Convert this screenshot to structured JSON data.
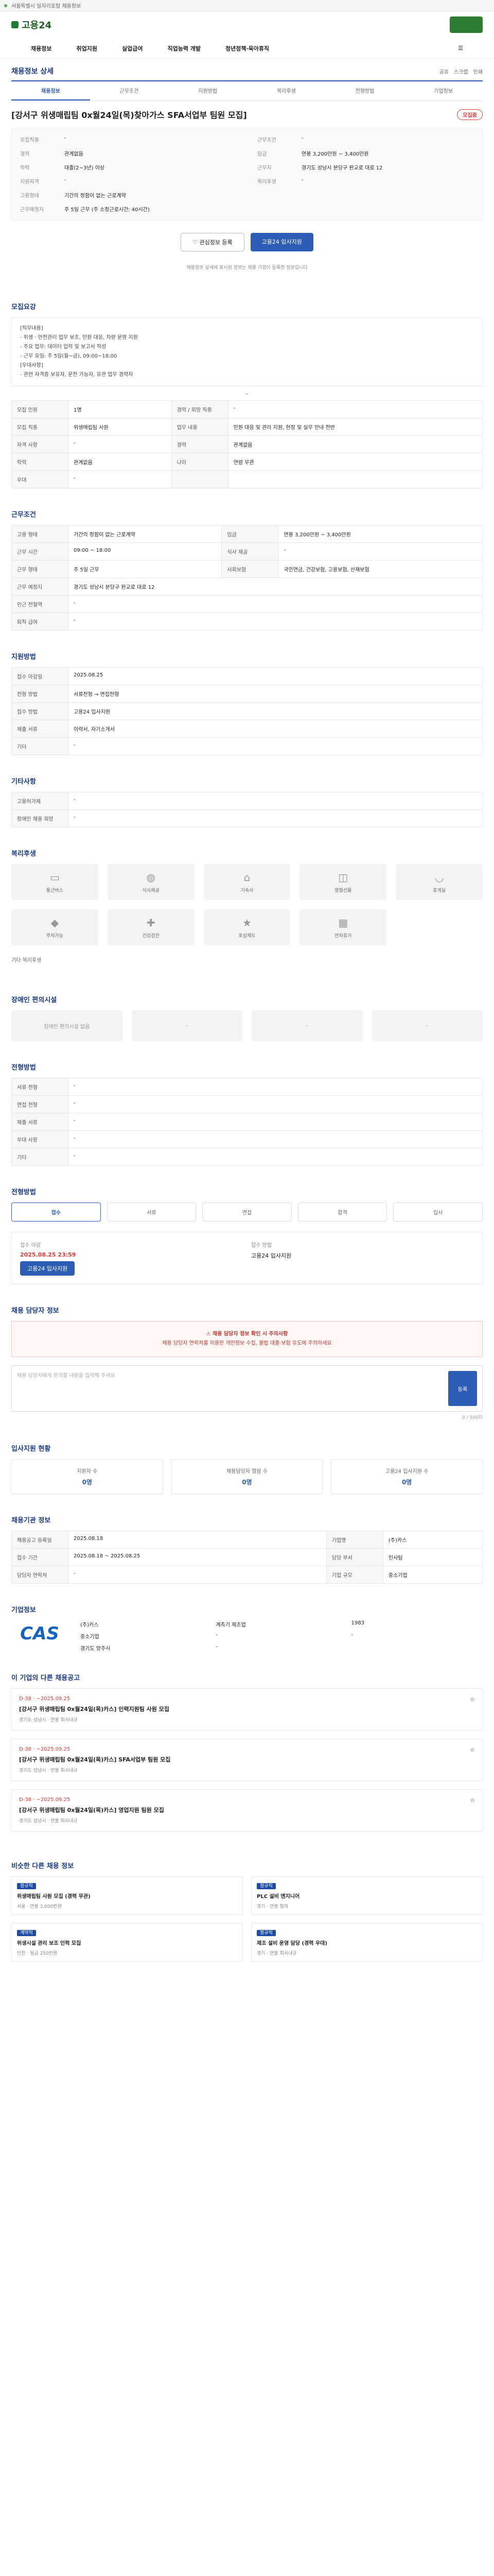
{
  "topbar": {
    "text": "서울특별시 일자리포털 채용정보"
  },
  "brand": {
    "name": "고용24"
  },
  "gnb": [
    "채용정보",
    "취업지원",
    "실업급여",
    "직업능력 개발",
    "청년정책·육아휴직"
  ],
  "breadcrumb": "채용정보 상세",
  "actions": [
    "공유",
    "스크랩",
    "인쇄"
  ],
  "tabs": [
    "채용정보",
    "근무조건",
    "지원방법",
    "복리후생",
    "전형방법",
    "기업정보"
  ],
  "job": {
    "title": "[강서구 위생매립팀 0x월24일(목)찾아가스 SFA서업부 팀원 모집]",
    "status": "모집중"
  },
  "summary": {
    "left": [
      {
        "k": "모집직종",
        "v": "-"
      },
      {
        "k": "경력",
        "v": "관계없음"
      },
      {
        "k": "학력",
        "v": "대졸(2~3년) 이상"
      },
      {
        "k": "지원자격",
        "v": "-"
      },
      {
        "k": "고용형태",
        "v": "기간의 정함이 없는 근로계약"
      },
      {
        "k": "근무예정지",
        "v": "주 5일 근무 (주 소정근로시간: 40시간)"
      }
    ],
    "right": [
      {
        "k": "근무조건",
        "v": "-"
      },
      {
        "k": "임금",
        "v": "연봉 3,200만원 ~ 3,400만원"
      },
      {
        "k": "근무지",
        "v": "경기도 성남시 분당구 판교로 대로 12"
      },
      {
        "k": "복리후생",
        "v": "-"
      }
    ]
  },
  "buttons": {
    "scrap": "관심정보 등록",
    "apply": "고용24 입사지원"
  },
  "notice": "채용정보 상세에 표시된 정보는 채용 기업이 등록한 정보입니다",
  "recruit_section": "모집요강",
  "duty_box": [
    "[직무내용]",
    "- 위생 · 안전관리 업무 보조, 민원 대응, 차량 운영 지원",
    "- 주요 업무: 데이터 입력 및 보고서 작성",
    "- 근무 요일: 주 5일(월~금), 09:00~18:00",
    "[우대사항]",
    "- 관련 자격증 보유자, 운전 가능자, 유관 업무 경력자"
  ],
  "recruit_rows": [
    {
      "k1": "모집 인원",
      "v1": "1명",
      "k2": "경력 / 희망 직종",
      "v2": "-"
    },
    {
      "k1": "모집 직종",
      "v1": "위생매립팀 사원",
      "k2": "업무 내용",
      "v2": "민원 대응 및 관리 지원, 현장 및 실무 안내 전반"
    },
    {
      "k1": "자격 사항",
      "v1": "-",
      "k2": "경력",
      "v2": "관계없음"
    },
    {
      "k1": "학력",
      "v1": "관계없음",
      "k2": "나이",
      "v2": "연령 무관"
    },
    {
      "k1": "우대",
      "v1": "-",
      "k2": "",
      "v2": ""
    }
  ],
  "condition_section": "근무조건",
  "condition_rows": [
    {
      "k1": "고용 형태",
      "v1": "기간의 정함이 없는 근로계약",
      "k2": "임금",
      "v2": "연봉 3,200만원 ~ 3,400만원"
    },
    {
      "k1": "근무 시간",
      "v1": "09:00 ~ 18:00",
      "k2": "식사 제공",
      "v2": "-"
    },
    {
      "k1": "근무 형태",
      "v1": "주 5일 근무",
      "k2": "사회보험",
      "v2": "국민연금, 건강보험, 고용보험, 산재보험"
    },
    {
      "k1": "근무 예정지",
      "v1": "경기도 성남시 분당구 판교로 대로 12",
      "k2": "",
      "v2": ""
    },
    {
      "k1": "인근 전철역",
      "v1": "-",
      "k2": "",
      "v2": ""
    },
    {
      "k1": "퇴직 급여",
      "v1": "-",
      "k2": "",
      "v2": ""
    }
  ],
  "apply_section": "지원방법",
  "apply_rows": [
    {
      "k": "접수 마감일",
      "v": "2025.08.25"
    },
    {
      "k": "전형 방법",
      "v": "서류전형 → 면접전형"
    },
    {
      "k": "접수 방법",
      "v": "고용24 입사지원"
    },
    {
      "k": "제출 서류",
      "v": "이력서, 자기소개서"
    },
    {
      "k": "기타",
      "v": "-"
    }
  ],
  "etc_section": "기타사항",
  "etc_rows": [
    {
      "k": "고용허가제",
      "v": "-"
    },
    {
      "k": "장애인 채용 희망",
      "v": "-"
    }
  ],
  "welfare_section": "복리후생",
  "welfare_items": [
    {
      "icon": "bus-icon",
      "label": "통근버스"
    },
    {
      "icon": "meal-icon",
      "label": "식사제공"
    },
    {
      "icon": "home-icon",
      "label": "기숙사"
    },
    {
      "icon": "gift-icon",
      "label": "명절선물"
    },
    {
      "icon": "coffee-icon",
      "label": "휴게실"
    },
    {
      "icon": "car-icon",
      "label": "주차가능"
    },
    {
      "icon": "health-icon",
      "label": "건강검진"
    },
    {
      "icon": "award-icon",
      "label": "포상제도"
    },
    {
      "icon": "calendar-icon",
      "label": "연차휴가"
    }
  ],
  "welfare_etc": "기타 복리후생",
  "disabled_section": "장애인 편의시설",
  "disabled_items": [
    "장애인 편의시설 없음",
    "-",
    "-",
    "-"
  ],
  "method_section": "전형방법",
  "method_rows": [
    {
      "k": "서류 전형",
      "v": "-"
    },
    {
      "k": "면접 전형",
      "v": "-"
    },
    {
      "k": "제출 서류",
      "v": "-"
    },
    {
      "k": "우대 사항",
      "v": "-"
    },
    {
      "k": "기타",
      "v": "-"
    }
  ],
  "process_section": "전형방법",
  "process_chips": [
    "접수",
    "서류",
    "면접",
    "합격",
    "입사"
  ],
  "deadline": {
    "label": "접수 마감",
    "date": "2025.08.25 23:59",
    "method_label": "접수 방법",
    "method": "고용24 입사지원",
    "apply": "고용24 입사지원"
  },
  "warning": {
    "title": "채용 담당자 정보 확인 시 주의사항",
    "body": "채용 담당자 연락처를 이용한 개인정보 수집, 불법 대출·보험 유도에 주의하세요"
  },
  "qna_section": "채용 담당자 정보",
  "qna": {
    "placeholder": "채용 담당자에게 문의할 내용을 입력해 주세요",
    "button": "등록",
    "count": "0 / 500자"
  },
  "stats_section": "입사지원 현황",
  "stats": [
    {
      "k": "지원자 수",
      "v": "0명"
    },
    {
      "k": "채용담당자 열람 수",
      "v": "0명"
    },
    {
      "k": "고용24 입사지원 수",
      "v": "0명"
    }
  ],
  "info_section": "채용기관 정보",
  "info_rows": [
    {
      "k1": "채용공고 등록일",
      "v1": "2025.08.18",
      "k2": "기업명",
      "v2": "(주)카스"
    },
    {
      "k1": "접수 기간",
      "v1": "2025.08.18 ~ 2025.08.25",
      "k2": "담당 부서",
      "v2": "인사팀"
    },
    {
      "k1": "담당자 연락처",
      "v1": "-",
      "k2": "기업 규모",
      "v2": "중소기업"
    }
  ],
  "company_section": "기업정보",
  "company": {
    "logo": "CAS",
    "name": "(주)카스",
    "ceo": "-",
    "industry": "계측기 제조업",
    "size": "중소기업",
    "founded": "1983",
    "employees": "-",
    "address": "경기도 양주시",
    "homepage": "-"
  },
  "related_section": "이 기업의 다른 채용공고",
  "related": [
    {
      "d": "D-38 · ~2025.09.25",
      "t": "[강서구 위생매립팀 0x월24일(목)카스] 인력지원팀 사원 모집",
      "s": "경기도 성남시 · 연봉 회사내규"
    },
    {
      "d": "D-38 · ~2025.09.25",
      "t": "[강서구 위생매립팀 0x월24일(목)카스] SFA서업부 팀원 모집",
      "s": "경기도 성남시 · 연봉 회사내규"
    },
    {
      "d": "D-38 · ~2025.09.25",
      "t": "[강서구 위생매립팀 0x월24일(목)카스] 영업지원 팀원 모집",
      "s": "경기도 성남시 · 연봉 회사내규"
    }
  ],
  "similar_section": "비슷한 다른 채용 정보",
  "similar": [
    {
      "tag": "정규직",
      "t": "위생매립팀 사원 모집 (경력 무관)",
      "s": "서울 · 연봉 3,000만원"
    },
    {
      "tag": "정규직",
      "t": "PLC 설비 엔지니어",
      "s": "경기 · 연봉 협의"
    },
    {
      "tag": "계약직",
      "t": "위생시설 관리 보조 인력 모집",
      "s": "인천 · 월급 250만원"
    },
    {
      "tag": "정규직",
      "t": "제조 설비 운영 담당 (경력 우대)",
      "s": "경기 · 연봉 회사내규"
    }
  ]
}
